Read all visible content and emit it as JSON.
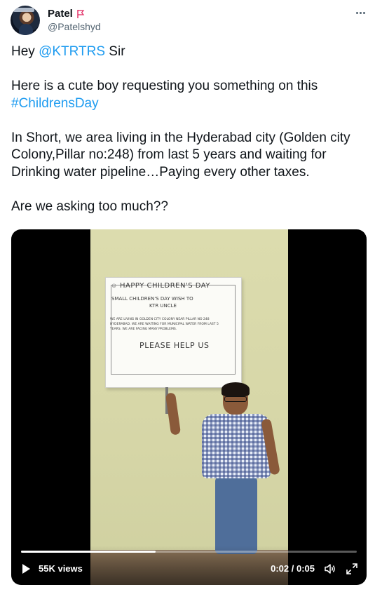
{
  "author": {
    "display_name": "Patel",
    "handle": "@Patelshyd"
  },
  "tweet": {
    "line1_prefix": "Hey ",
    "mention": "@KTRTRS",
    "line1_suffix": " Sir",
    "line2": "Here is a cute boy requesting you something on this",
    "hashtag": "#ChildrensDay",
    "paragraph3": "In Short, we area living in the Hyderabad city (Golden city Colony,Pillar no:248) from last 5 years and waiting for Drinking water pipeline…Paying every other taxes.",
    "paragraph4": "Are we asking too much??"
  },
  "video": {
    "views": "55K views",
    "time": "0:02 / 0:05",
    "progress": 0.4
  },
  "poster": {
    "title": "HAPPY CHILDREN'S DAY",
    "line2": "SMALL CHILDREN'S DAY WISH TO",
    "line3": "KTR UNCLE",
    "body": "WE ARE LIVING IN GOLDEN CITY COLONY NEAR PILLAR NO 248 HYDERABAD. WE ARE WAITING FOR MUNICIPAL WATER FROM LAST 5 YEARS. WE ARE FACING MANY PROBLEMS.",
    "plea": "PLEASE HELP US"
  },
  "colors": {
    "link": "#1d9bf0",
    "text": "#0f1419",
    "muted": "#536471",
    "flag": "#e0245e"
  }
}
